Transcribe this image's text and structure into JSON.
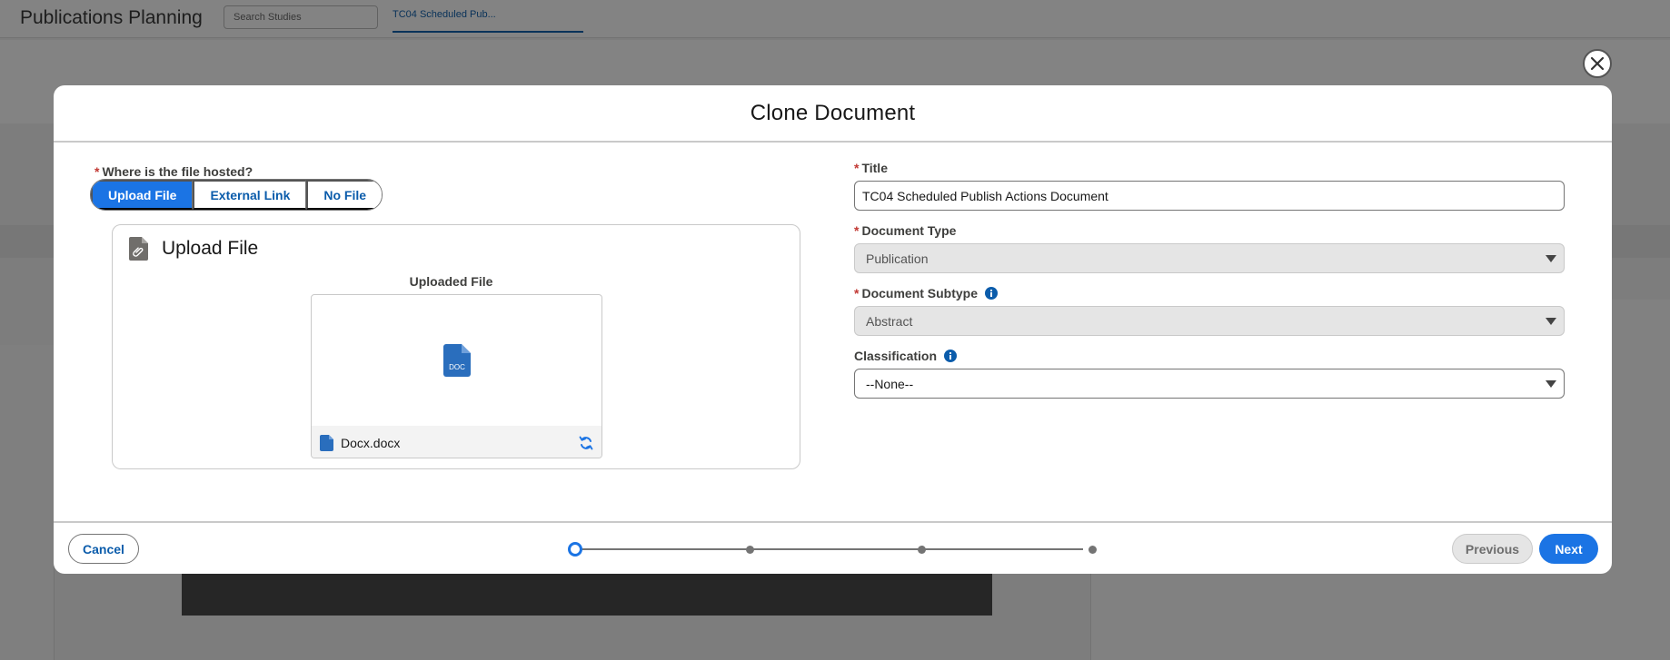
{
  "background": {
    "app_title": "Publications Planning",
    "search_placeholder": "Search Studies",
    "active_tab": "TC04 Scheduled Pub..."
  },
  "modal": {
    "title": "Clone Document",
    "close_icon": "close-icon"
  },
  "hosting": {
    "label": "Where is the file hosted?",
    "options": [
      "Upload File",
      "External Link",
      "No File"
    ],
    "selected": "Upload File"
  },
  "upload": {
    "card_title": "Upload File",
    "card_icon": "attachment-document-icon",
    "uploaded_label": "Uploaded File",
    "file_name": "Docx.docx",
    "file_type_badge": "DOC",
    "replace_icon": "sync-icon"
  },
  "fields": {
    "title": {
      "label": "Title",
      "value": "TC04 Scheduled Publish Actions Document",
      "required": true
    },
    "document_type": {
      "label": "Document Type",
      "value": "Publication",
      "required": true,
      "disabled": true
    },
    "document_subtype": {
      "label": "Document Subtype",
      "value": "Abstract",
      "required": true,
      "disabled": true
    },
    "classification": {
      "label": "Classification",
      "value": "--None--",
      "required": false
    }
  },
  "footer": {
    "cancel_label": "Cancel",
    "previous_label": "Previous",
    "next_label": "Next",
    "progress": {
      "total_steps": 4,
      "current_step": 1
    }
  },
  "colors": {
    "brand": "#1b74e4",
    "link": "#0b5cab",
    "required": "#c23934",
    "doc_icon": "#2a6ebd"
  }
}
